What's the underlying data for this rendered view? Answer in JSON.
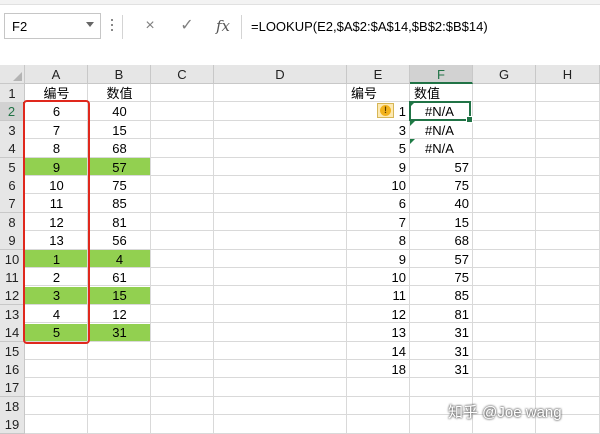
{
  "name_box": "F2",
  "formula_buttons": {
    "cancel": "×",
    "enter": "✓",
    "fx": "fx"
  },
  "formula": "=LOOKUP(E2,$A$2:$A$14,$B$2:$B$14)",
  "columns": [
    "A",
    "B",
    "C",
    "D",
    "E",
    "F",
    "G",
    "H"
  ],
  "active_column": "F",
  "rows": [
    "1",
    "2",
    "3",
    "4",
    "5",
    "6",
    "7",
    "8",
    "9",
    "10",
    "11",
    "12",
    "13",
    "14",
    "15",
    "16",
    "17",
    "18",
    "19"
  ],
  "active_row": "2",
  "headers": {
    "a1": "编号",
    "b1": "数值",
    "e1": "编号",
    "f1": "数值"
  },
  "col_a": [
    "6",
    "7",
    "8",
    "9",
    "10",
    "11",
    "12",
    "13",
    "1",
    "2",
    "3",
    "4",
    "5"
  ],
  "col_b": [
    "40",
    "15",
    "68",
    "57",
    "75",
    "85",
    "81",
    "56",
    "4",
    "61",
    "15",
    "12",
    "31"
  ],
  "highlight_color": "#92d050",
  "highlighted_rows_ab": [
    "5",
    "10",
    "12",
    "14"
  ],
  "col_e": [
    "1",
    "3",
    "5",
    "9",
    "10",
    "6",
    "7",
    "8",
    "9",
    "10",
    "11",
    "12",
    "13",
    "14",
    "18"
  ],
  "col_f": [
    "#N/A",
    "#N/A",
    "#N/A",
    "57",
    "75",
    "40",
    "15",
    "68",
    "57",
    "75",
    "85",
    "81",
    "31",
    "31",
    "31"
  ],
  "warning_icon": "!",
  "watermark": "知乎 @Joe wang"
}
